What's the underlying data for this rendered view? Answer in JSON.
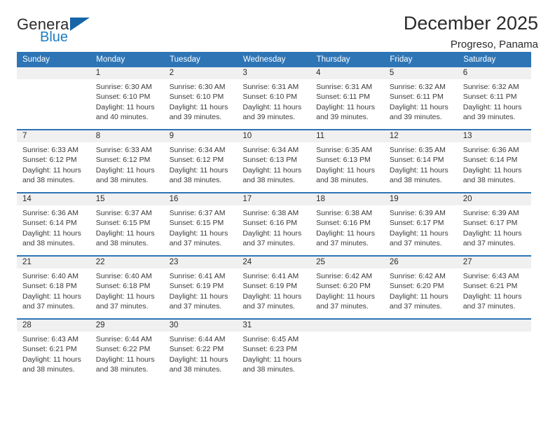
{
  "brand": {
    "word_top": "General",
    "word_bottom": "Blue",
    "triangle_color": "#1565a8",
    "blue_text_color": "#1d7cc4"
  },
  "header": {
    "title": "December 2025",
    "subtitle": "Progreso, Panama",
    "accent_color": "#2e75b6",
    "daynum_band_color": "#f0f0f0"
  },
  "weekday_headers": [
    "Sunday",
    "Monday",
    "Tuesday",
    "Wednesday",
    "Thursday",
    "Friday",
    "Saturday"
  ],
  "labels": {
    "sunrise_prefix": "Sunrise:",
    "sunset_prefix": "Sunset:",
    "daylight_prefix": "Daylight:"
  },
  "weeks": [
    [
      {
        "day": "",
        "sunrise": "",
        "sunset": "",
        "daylight_line1": "",
        "daylight_line2": ""
      },
      {
        "day": "1",
        "sunrise": "Sunrise: 6:30 AM",
        "sunset": "Sunset: 6:10 PM",
        "daylight_line1": "Daylight: 11 hours",
        "daylight_line2": "and 40 minutes."
      },
      {
        "day": "2",
        "sunrise": "Sunrise: 6:30 AM",
        "sunset": "Sunset: 6:10 PM",
        "daylight_line1": "Daylight: 11 hours",
        "daylight_line2": "and 39 minutes."
      },
      {
        "day": "3",
        "sunrise": "Sunrise: 6:31 AM",
        "sunset": "Sunset: 6:10 PM",
        "daylight_line1": "Daylight: 11 hours",
        "daylight_line2": "and 39 minutes."
      },
      {
        "day": "4",
        "sunrise": "Sunrise: 6:31 AM",
        "sunset": "Sunset: 6:11 PM",
        "daylight_line1": "Daylight: 11 hours",
        "daylight_line2": "and 39 minutes."
      },
      {
        "day": "5",
        "sunrise": "Sunrise: 6:32 AM",
        "sunset": "Sunset: 6:11 PM",
        "daylight_line1": "Daylight: 11 hours",
        "daylight_line2": "and 39 minutes."
      },
      {
        "day": "6",
        "sunrise": "Sunrise: 6:32 AM",
        "sunset": "Sunset: 6:11 PM",
        "daylight_line1": "Daylight: 11 hours",
        "daylight_line2": "and 39 minutes."
      }
    ],
    [
      {
        "day": "7",
        "sunrise": "Sunrise: 6:33 AM",
        "sunset": "Sunset: 6:12 PM",
        "daylight_line1": "Daylight: 11 hours",
        "daylight_line2": "and 38 minutes."
      },
      {
        "day": "8",
        "sunrise": "Sunrise: 6:33 AM",
        "sunset": "Sunset: 6:12 PM",
        "daylight_line1": "Daylight: 11 hours",
        "daylight_line2": "and 38 minutes."
      },
      {
        "day": "9",
        "sunrise": "Sunrise: 6:34 AM",
        "sunset": "Sunset: 6:12 PM",
        "daylight_line1": "Daylight: 11 hours",
        "daylight_line2": "and 38 minutes."
      },
      {
        "day": "10",
        "sunrise": "Sunrise: 6:34 AM",
        "sunset": "Sunset: 6:13 PM",
        "daylight_line1": "Daylight: 11 hours",
        "daylight_line2": "and 38 minutes."
      },
      {
        "day": "11",
        "sunrise": "Sunrise: 6:35 AM",
        "sunset": "Sunset: 6:13 PM",
        "daylight_line1": "Daylight: 11 hours",
        "daylight_line2": "and 38 minutes."
      },
      {
        "day": "12",
        "sunrise": "Sunrise: 6:35 AM",
        "sunset": "Sunset: 6:14 PM",
        "daylight_line1": "Daylight: 11 hours",
        "daylight_line2": "and 38 minutes."
      },
      {
        "day": "13",
        "sunrise": "Sunrise: 6:36 AM",
        "sunset": "Sunset: 6:14 PM",
        "daylight_line1": "Daylight: 11 hours",
        "daylight_line2": "and 38 minutes."
      }
    ],
    [
      {
        "day": "14",
        "sunrise": "Sunrise: 6:36 AM",
        "sunset": "Sunset: 6:14 PM",
        "daylight_line1": "Daylight: 11 hours",
        "daylight_line2": "and 38 minutes."
      },
      {
        "day": "15",
        "sunrise": "Sunrise: 6:37 AM",
        "sunset": "Sunset: 6:15 PM",
        "daylight_line1": "Daylight: 11 hours",
        "daylight_line2": "and 38 minutes."
      },
      {
        "day": "16",
        "sunrise": "Sunrise: 6:37 AM",
        "sunset": "Sunset: 6:15 PM",
        "daylight_line1": "Daylight: 11 hours",
        "daylight_line2": "and 37 minutes."
      },
      {
        "day": "17",
        "sunrise": "Sunrise: 6:38 AM",
        "sunset": "Sunset: 6:16 PM",
        "daylight_line1": "Daylight: 11 hours",
        "daylight_line2": "and 37 minutes."
      },
      {
        "day": "18",
        "sunrise": "Sunrise: 6:38 AM",
        "sunset": "Sunset: 6:16 PM",
        "daylight_line1": "Daylight: 11 hours",
        "daylight_line2": "and 37 minutes."
      },
      {
        "day": "19",
        "sunrise": "Sunrise: 6:39 AM",
        "sunset": "Sunset: 6:17 PM",
        "daylight_line1": "Daylight: 11 hours",
        "daylight_line2": "and 37 minutes."
      },
      {
        "day": "20",
        "sunrise": "Sunrise: 6:39 AM",
        "sunset": "Sunset: 6:17 PM",
        "daylight_line1": "Daylight: 11 hours",
        "daylight_line2": "and 37 minutes."
      }
    ],
    [
      {
        "day": "21",
        "sunrise": "Sunrise: 6:40 AM",
        "sunset": "Sunset: 6:18 PM",
        "daylight_line1": "Daylight: 11 hours",
        "daylight_line2": "and 37 minutes."
      },
      {
        "day": "22",
        "sunrise": "Sunrise: 6:40 AM",
        "sunset": "Sunset: 6:18 PM",
        "daylight_line1": "Daylight: 11 hours",
        "daylight_line2": "and 37 minutes."
      },
      {
        "day": "23",
        "sunrise": "Sunrise: 6:41 AM",
        "sunset": "Sunset: 6:19 PM",
        "daylight_line1": "Daylight: 11 hours",
        "daylight_line2": "and 37 minutes."
      },
      {
        "day": "24",
        "sunrise": "Sunrise: 6:41 AM",
        "sunset": "Sunset: 6:19 PM",
        "daylight_line1": "Daylight: 11 hours",
        "daylight_line2": "and 37 minutes."
      },
      {
        "day": "25",
        "sunrise": "Sunrise: 6:42 AM",
        "sunset": "Sunset: 6:20 PM",
        "daylight_line1": "Daylight: 11 hours",
        "daylight_line2": "and 37 minutes."
      },
      {
        "day": "26",
        "sunrise": "Sunrise: 6:42 AM",
        "sunset": "Sunset: 6:20 PM",
        "daylight_line1": "Daylight: 11 hours",
        "daylight_line2": "and 37 minutes."
      },
      {
        "day": "27",
        "sunrise": "Sunrise: 6:43 AM",
        "sunset": "Sunset: 6:21 PM",
        "daylight_line1": "Daylight: 11 hours",
        "daylight_line2": "and 37 minutes."
      }
    ],
    [
      {
        "day": "28",
        "sunrise": "Sunrise: 6:43 AM",
        "sunset": "Sunset: 6:21 PM",
        "daylight_line1": "Daylight: 11 hours",
        "daylight_line2": "and 38 minutes."
      },
      {
        "day": "29",
        "sunrise": "Sunrise: 6:44 AM",
        "sunset": "Sunset: 6:22 PM",
        "daylight_line1": "Daylight: 11 hours",
        "daylight_line2": "and 38 minutes."
      },
      {
        "day": "30",
        "sunrise": "Sunrise: 6:44 AM",
        "sunset": "Sunset: 6:22 PM",
        "daylight_line1": "Daylight: 11 hours",
        "daylight_line2": "and 38 minutes."
      },
      {
        "day": "31",
        "sunrise": "Sunrise: 6:45 AM",
        "sunset": "Sunset: 6:23 PM",
        "daylight_line1": "Daylight: 11 hours",
        "daylight_line2": "and 38 minutes."
      },
      {
        "day": "",
        "sunrise": "",
        "sunset": "",
        "daylight_line1": "",
        "daylight_line2": ""
      },
      {
        "day": "",
        "sunrise": "",
        "sunset": "",
        "daylight_line1": "",
        "daylight_line2": ""
      },
      {
        "day": "",
        "sunrise": "",
        "sunset": "",
        "daylight_line1": "",
        "daylight_line2": ""
      }
    ]
  ]
}
